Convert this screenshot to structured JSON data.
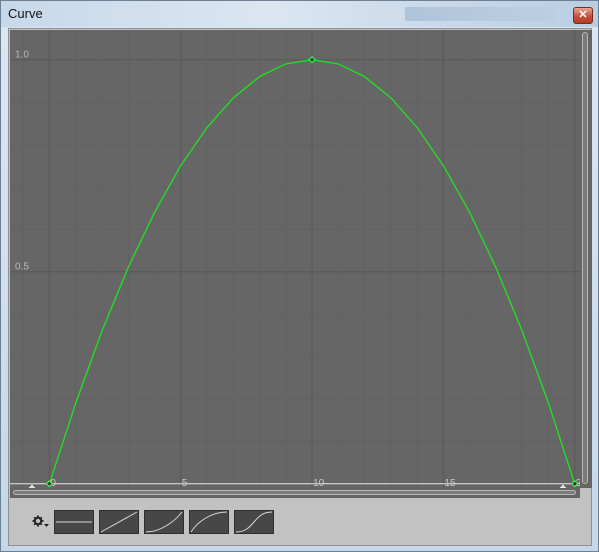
{
  "window": {
    "title": "Curve",
    "close_glyph": "✕",
    "colors": {
      "graph_bg": "#666666",
      "curve": "#22dd22",
      "grid": "#5a5a5a"
    }
  },
  "graph": {
    "y_ticks": [
      "1.0",
      "0.5"
    ],
    "x_ticks": [
      "0",
      "5",
      "10",
      "15",
      "20"
    ],
    "left_key_gear_icon": "gear-icon",
    "right_key_gear_icon": "gear-icon"
  },
  "chart_data": {
    "type": "line",
    "title": "",
    "xlabel": "",
    "ylabel": "",
    "xlim": [
      -1.5,
      20.2
    ],
    "ylim": [
      -0.01,
      1.07
    ],
    "x": [
      0,
      1,
      2,
      3,
      4,
      5,
      6,
      7,
      8,
      9,
      10,
      11,
      12,
      13,
      14,
      15,
      16,
      17,
      18,
      19,
      20
    ],
    "series": [
      {
        "values": [
          0,
          0.19,
          0.36,
          0.51,
          0.64,
          0.75,
          0.84,
          0.91,
          0.96,
          0.99,
          1.0,
          0.99,
          0.96,
          0.91,
          0.84,
          0.75,
          0.64,
          0.51,
          0.36,
          0.19,
          0
        ]
      }
    ],
    "keyframes": [
      {
        "x": 0,
        "y": 0
      },
      {
        "x": 10,
        "y": 1.0
      },
      {
        "x": 20,
        "y": 0
      }
    ]
  },
  "presets": {
    "gear_icon": "gear-icon",
    "items": [
      "constant-preset",
      "linear-preset",
      "ease-in-preset",
      "ease-out-preset",
      "ease-in-out-preset"
    ]
  }
}
